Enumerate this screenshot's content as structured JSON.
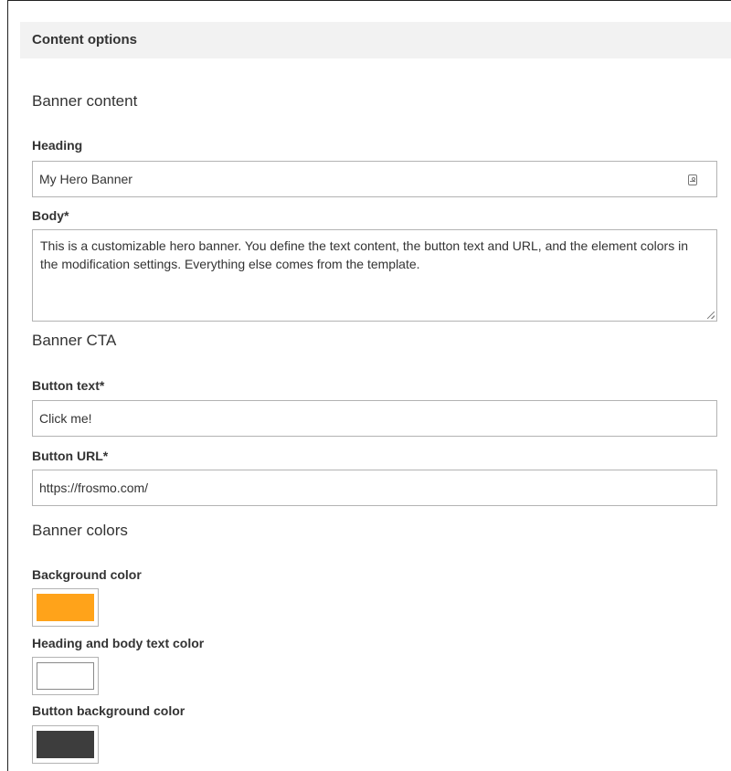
{
  "header": {
    "title": "Content options"
  },
  "sections": {
    "banner_content": "Banner content",
    "banner_cta": "Banner CTA",
    "banner_colors": "Banner colors"
  },
  "fields": {
    "heading": {
      "label": "Heading",
      "value": "My Hero Banner",
      "icon": "contact-card-icon"
    },
    "body": {
      "label": "Body*",
      "value": "This is a customizable hero banner. You define the text content, the button text and URL, and the element colors in the modification settings. Everything else comes from the template."
    },
    "button_text": {
      "label": "Button text*",
      "value": "Click me!"
    },
    "button_url": {
      "label": "Button URL*",
      "value": "https://frosmo.com/"
    }
  },
  "colors": {
    "background": {
      "label": "Background color",
      "value": "#ffa31a"
    },
    "text": {
      "label": "Heading and body text color",
      "value": "#ffffff"
    },
    "button_background": {
      "label": "Button background color",
      "value": "#3d3d3d"
    }
  }
}
